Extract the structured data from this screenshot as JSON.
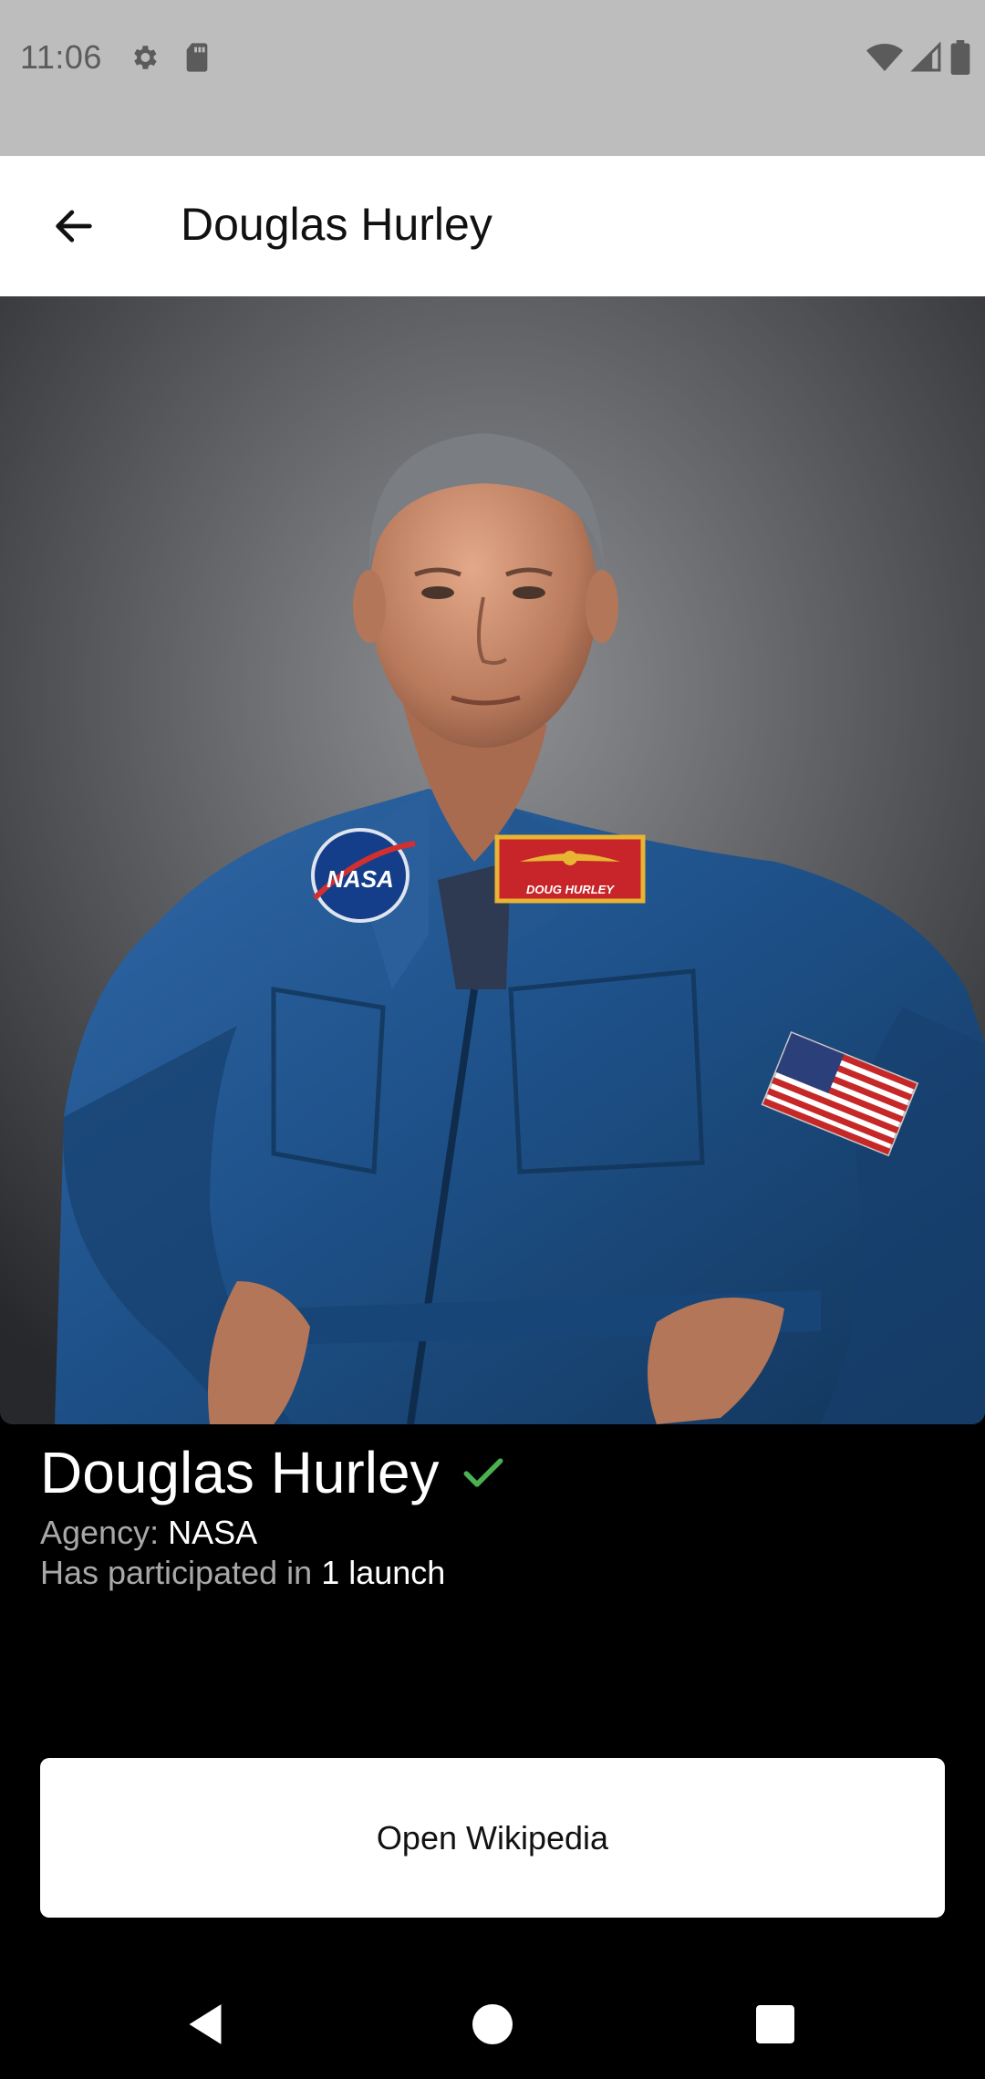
{
  "status_bar": {
    "time": "11:06",
    "icons": [
      "gear-icon",
      "sd-card-icon",
      "wifi-icon",
      "cell-signal-icon",
      "battery-icon"
    ]
  },
  "app_bar": {
    "title": "Douglas Hurley",
    "back_icon": "arrow-left-icon"
  },
  "astronaut": {
    "name": "Douglas Hurley",
    "status_icon": "check-icon",
    "status_color": "#4caf50",
    "agency_label": "Agency:",
    "agency": "NASA",
    "launches_label": "Has participated in",
    "launches": "1 launch",
    "patches": {
      "agency_patch": "NASA",
      "name_tag": "DOUG HURLEY"
    }
  },
  "actions": {
    "open_wikipedia": "Open Wikipedia"
  },
  "nav_bar": {
    "icons": [
      "back-triangle-icon",
      "home-circle-icon",
      "recents-square-icon"
    ]
  },
  "colors": {
    "suit_blue": "#1d4f86",
    "background": "#000000",
    "status_bar": "#bdbdbd"
  }
}
